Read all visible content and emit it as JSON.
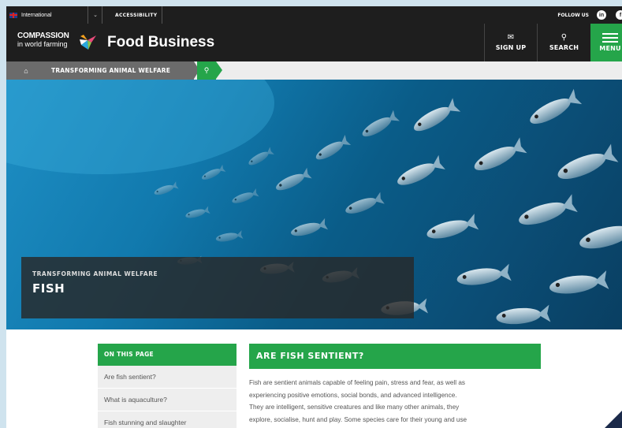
{
  "topbar": {
    "language": "International",
    "accessibility": "ACCESSIBILITY",
    "follow_us": "FOLLOW US"
  },
  "header": {
    "logo_line1": "COMPASSION",
    "logo_line2": "in world farming",
    "site_name": "Food Business",
    "signup": "SIGN UP",
    "search": "SEARCH",
    "menu": "MENU"
  },
  "breadcrumb": {
    "current": "TRANSFORMING ANIMAL WELFARE"
  },
  "hero": {
    "kicker": "TRANSFORMING ANIMAL WELFARE",
    "title": "FISH"
  },
  "toc": {
    "heading": "ON THIS PAGE",
    "items": [
      "Are fish sentient?",
      "What is aquaculture?",
      "Fish stunning and slaughter"
    ]
  },
  "article": {
    "heading": "ARE FISH SENTIENT?",
    "lines": [
      "Fish are sentient animals capable of feeling pain, stress and fear, as well as",
      "experiencing positive emotions, social bonds, and advanced intelligence.",
      "They are intelligent, sensitive creatures and like many other animals, they",
      "explore, socialise, hunt and play. Some species care for their young and use"
    ]
  },
  "colors": {
    "brand_green": "#25a54a",
    "dark": "#1e1e1e"
  }
}
